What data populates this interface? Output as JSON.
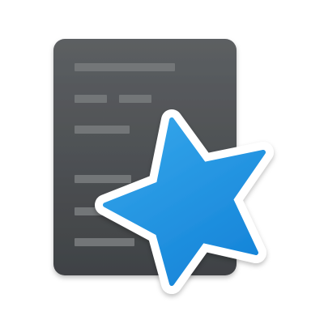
{
  "icon": {
    "name": "document-star-icon",
    "colors": {
      "background": "#ffffff",
      "document_top": "#5c5f62",
      "document_bottom": "#3f4245",
      "document_lines": "#737678",
      "star_outline": "#ffffff",
      "star_light": "#34a5ea",
      "star_dark": "#1483d8"
    }
  }
}
